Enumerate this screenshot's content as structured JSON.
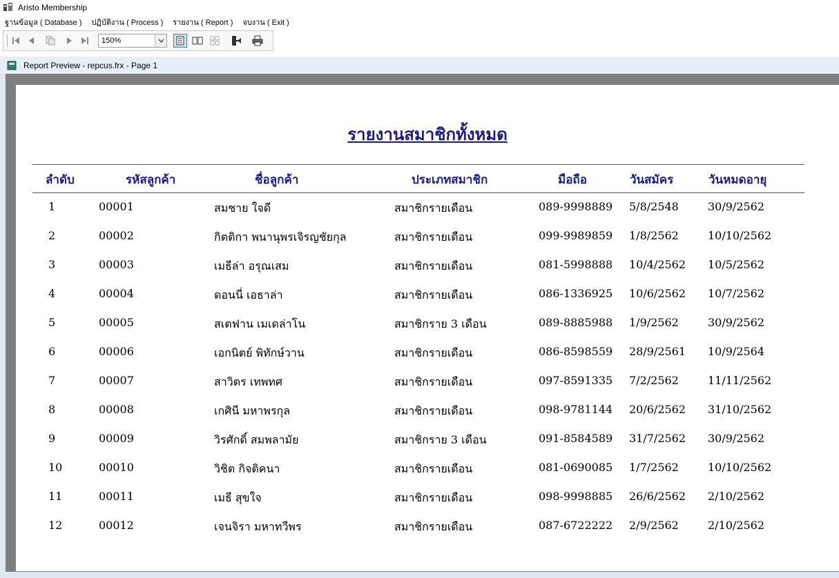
{
  "window": {
    "title": "Aristo Membership"
  },
  "menu": [
    "ฐานข้อมูล ( Database )",
    "ปฏิบัติงาน ( Process )",
    "รายงาน ( Report )",
    "จบงาน ( Exit )"
  ],
  "toolbar": {
    "zoom": "150%",
    "icons": [
      "first-page-icon",
      "previous-page-icon",
      "go-to-page-icon",
      "next-page-icon",
      "last-page-icon",
      "one-page-view-icon",
      "two-page-view-icon",
      "multi-page-view-icon",
      "close-preview-icon",
      "print-icon"
    ]
  },
  "report_window": {
    "title": "Report Preview - repcus.frx - Page 1"
  },
  "report": {
    "title": "รายงานสมาชิกทั้งหมด",
    "columns": [
      "ลำดับ",
      "รหัสลูกค้า",
      "ชื่อลูกค้า",
      "ประเภทสมาชิก",
      "มือถือ",
      "วันสมัคร",
      "วันหมดอายุ"
    ],
    "rows": [
      [
        "1",
        "00001",
        "สมชาย ใจดี",
        "สมาชิกรายเดือน",
        "089-9998889",
        "5/8/2548",
        "30/9/2562"
      ],
      [
        "2",
        "00002",
        "กิตติกา พนานุพรเจิรญชัยกุล",
        "สมาชิกรายเดือน",
        "099-9989859",
        "1/8/2562",
        "10/10/2562"
      ],
      [
        "3",
        "00003",
        "เมธีล่า อรุณเสม",
        "สมาชิกรายเดือน",
        "081-5998888",
        "10/4/2562",
        "10/5/2562"
      ],
      [
        "4",
        "00004",
        "ดอนนี่ เอธาล่า",
        "สมาชิกรายเดือน",
        "086-1336925",
        "10/6/2562",
        "10/7/2562"
      ],
      [
        "5",
        "00005",
        "สเตฟาน เมเดล่าโน",
        "สมาชิกราย 3 เดือน",
        "089-8885988",
        "1/9/2562",
        "30/9/2562"
      ],
      [
        "6",
        "00006",
        "เอกนิตย์ พิทักษ์วาน",
        "สมาชิกรายเดือน",
        "086-8598559",
        "28/9/2561",
        "10/9/2564"
      ],
      [
        "7",
        "00007",
        "สาวิตร เทพทศ",
        "สมาชิกรายเดือน",
        "097-8591335",
        "7/2/2562",
        "11/11/2562"
      ],
      [
        "8",
        "00008",
        "เกศินี มหาพรกุล",
        "สมาชิกรายเดือน",
        "098-9781144",
        "20/6/2562",
        "31/10/2562"
      ],
      [
        "9",
        "00009",
        "วิรศักดิ์ สมพลามัย",
        "สมาชิกราย 3 เดือน",
        "091-8584589",
        "31/7/2562",
        "30/9/2562"
      ],
      [
        "10",
        "00010",
        "วิชิต กิจติคนา",
        "สมาชิกรายเดือน",
        "081-0690085",
        "1/7/2562",
        "10/10/2562"
      ],
      [
        "11",
        "00011",
        "เมธี สุขใจ",
        "สมาชิกรายเดือน",
        "098-9998885",
        "26/6/2562",
        "2/10/2562"
      ],
      [
        "12",
        "00012",
        "เจนจิรา มหาทวีพร",
        "สมาชิกรายเดือน",
        "087-6722222",
        "2/9/2562",
        "2/10/2562"
      ]
    ]
  }
}
